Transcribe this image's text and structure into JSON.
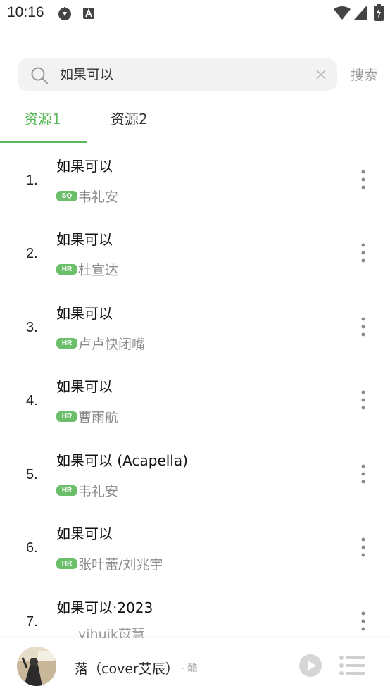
{
  "status_bar": {
    "time": "10:16"
  },
  "search": {
    "query": "如果可以",
    "button_label": "搜索"
  },
  "tabs": [
    {
      "label": "资源1",
      "active": true
    },
    {
      "label": "资源2",
      "active": false
    }
  ],
  "results": [
    {
      "index": "1.",
      "title": "如果可以",
      "badge": "SQ",
      "artist": "韦礼安"
    },
    {
      "index": "2.",
      "title": "如果可以",
      "badge": "HR",
      "artist": "杜宣达"
    },
    {
      "index": "3.",
      "title": "如果可以",
      "badge": "HR",
      "artist": "卢卢快闭嘴"
    },
    {
      "index": "4.",
      "title": "如果可以",
      "badge": "HR",
      "artist": "曹雨航"
    },
    {
      "index": "5.",
      "title": "如果可以 (Acapella)",
      "badge": "HR",
      "artist": "韦礼安"
    },
    {
      "index": "6.",
      "title": "如果可以",
      "badge": "HR",
      "artist": "张叶蕾/刘兆宇"
    },
    {
      "index": "7.",
      "title": "如果可以·2023",
      "badge": "",
      "artist": "yihuik苡慧"
    }
  ],
  "player": {
    "title": "落（cover艾辰）",
    "artist": "- 酷"
  },
  "colors": {
    "accent": "#5cb85c",
    "badge": "#6bbf6b",
    "muted_text": "#8a8a8a"
  }
}
